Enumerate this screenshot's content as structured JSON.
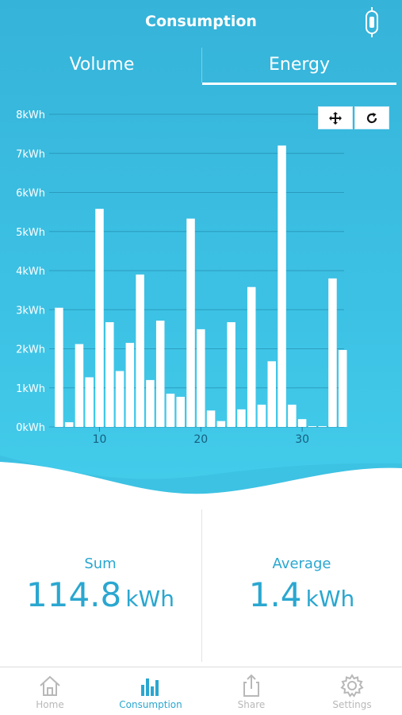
{
  "header": {
    "title": "Consumption",
    "device_icon": "meter-device-icon"
  },
  "tabs": [
    {
      "label": "Volume",
      "active": false
    },
    {
      "label": "Energy",
      "active": true
    }
  ],
  "chart_controls": {
    "move_icon": "move-arrows-icon",
    "reset_icon": "refresh-icon"
  },
  "chart_data": {
    "type": "bar",
    "x": [
      6,
      7,
      8,
      9,
      10,
      11,
      12,
      13,
      14,
      15,
      16,
      17,
      18,
      19,
      20,
      21,
      22,
      23,
      24,
      25,
      26,
      27,
      28,
      29,
      30,
      31,
      32,
      33,
      34
    ],
    "values": [
      3.05,
      0.12,
      2.12,
      1.27,
      5.58,
      2.68,
      1.43,
      2.15,
      3.9,
      1.2,
      2.72,
      0.85,
      0.77,
      5.33,
      2.5,
      0.42,
      0.15,
      2.68,
      0.45,
      3.58,
      0.57,
      1.68,
      7.2,
      0.57,
      0.2,
      0.02,
      0.02,
      3.8,
      1.97
    ],
    "ylim": [
      0,
      8
    ],
    "yticks": [
      "0kWh",
      "1kWh",
      "2kWh",
      "3kWh",
      "4kWh",
      "5kWh",
      "6kWh",
      "7kWh",
      "8kWh"
    ],
    "xticks": [
      {
        "value": 10,
        "label": "10"
      },
      {
        "value": 20,
        "label": "20"
      },
      {
        "value": 30,
        "label": "30"
      }
    ],
    "grid": true,
    "bar_color": "#ffffff"
  },
  "stats": {
    "sum": {
      "label": "Sum",
      "value": "114.8",
      "unit": "kWh"
    },
    "average": {
      "label": "Average",
      "value": "1.4",
      "unit": "kWh"
    }
  },
  "nav": [
    {
      "label": "Home",
      "icon": "home-icon",
      "active": false
    },
    {
      "label": "Consumption",
      "icon": "bar-chart-icon",
      "active": true
    },
    {
      "label": "Share",
      "icon": "share-icon",
      "active": false
    },
    {
      "label": "Settings",
      "icon": "gear-icon",
      "active": false
    }
  ],
  "colors": {
    "accent": "#2aa7d0",
    "header_top": "#36b3d9",
    "header_bottom": "#44cdeb",
    "inactive": "#b8b8b8"
  }
}
